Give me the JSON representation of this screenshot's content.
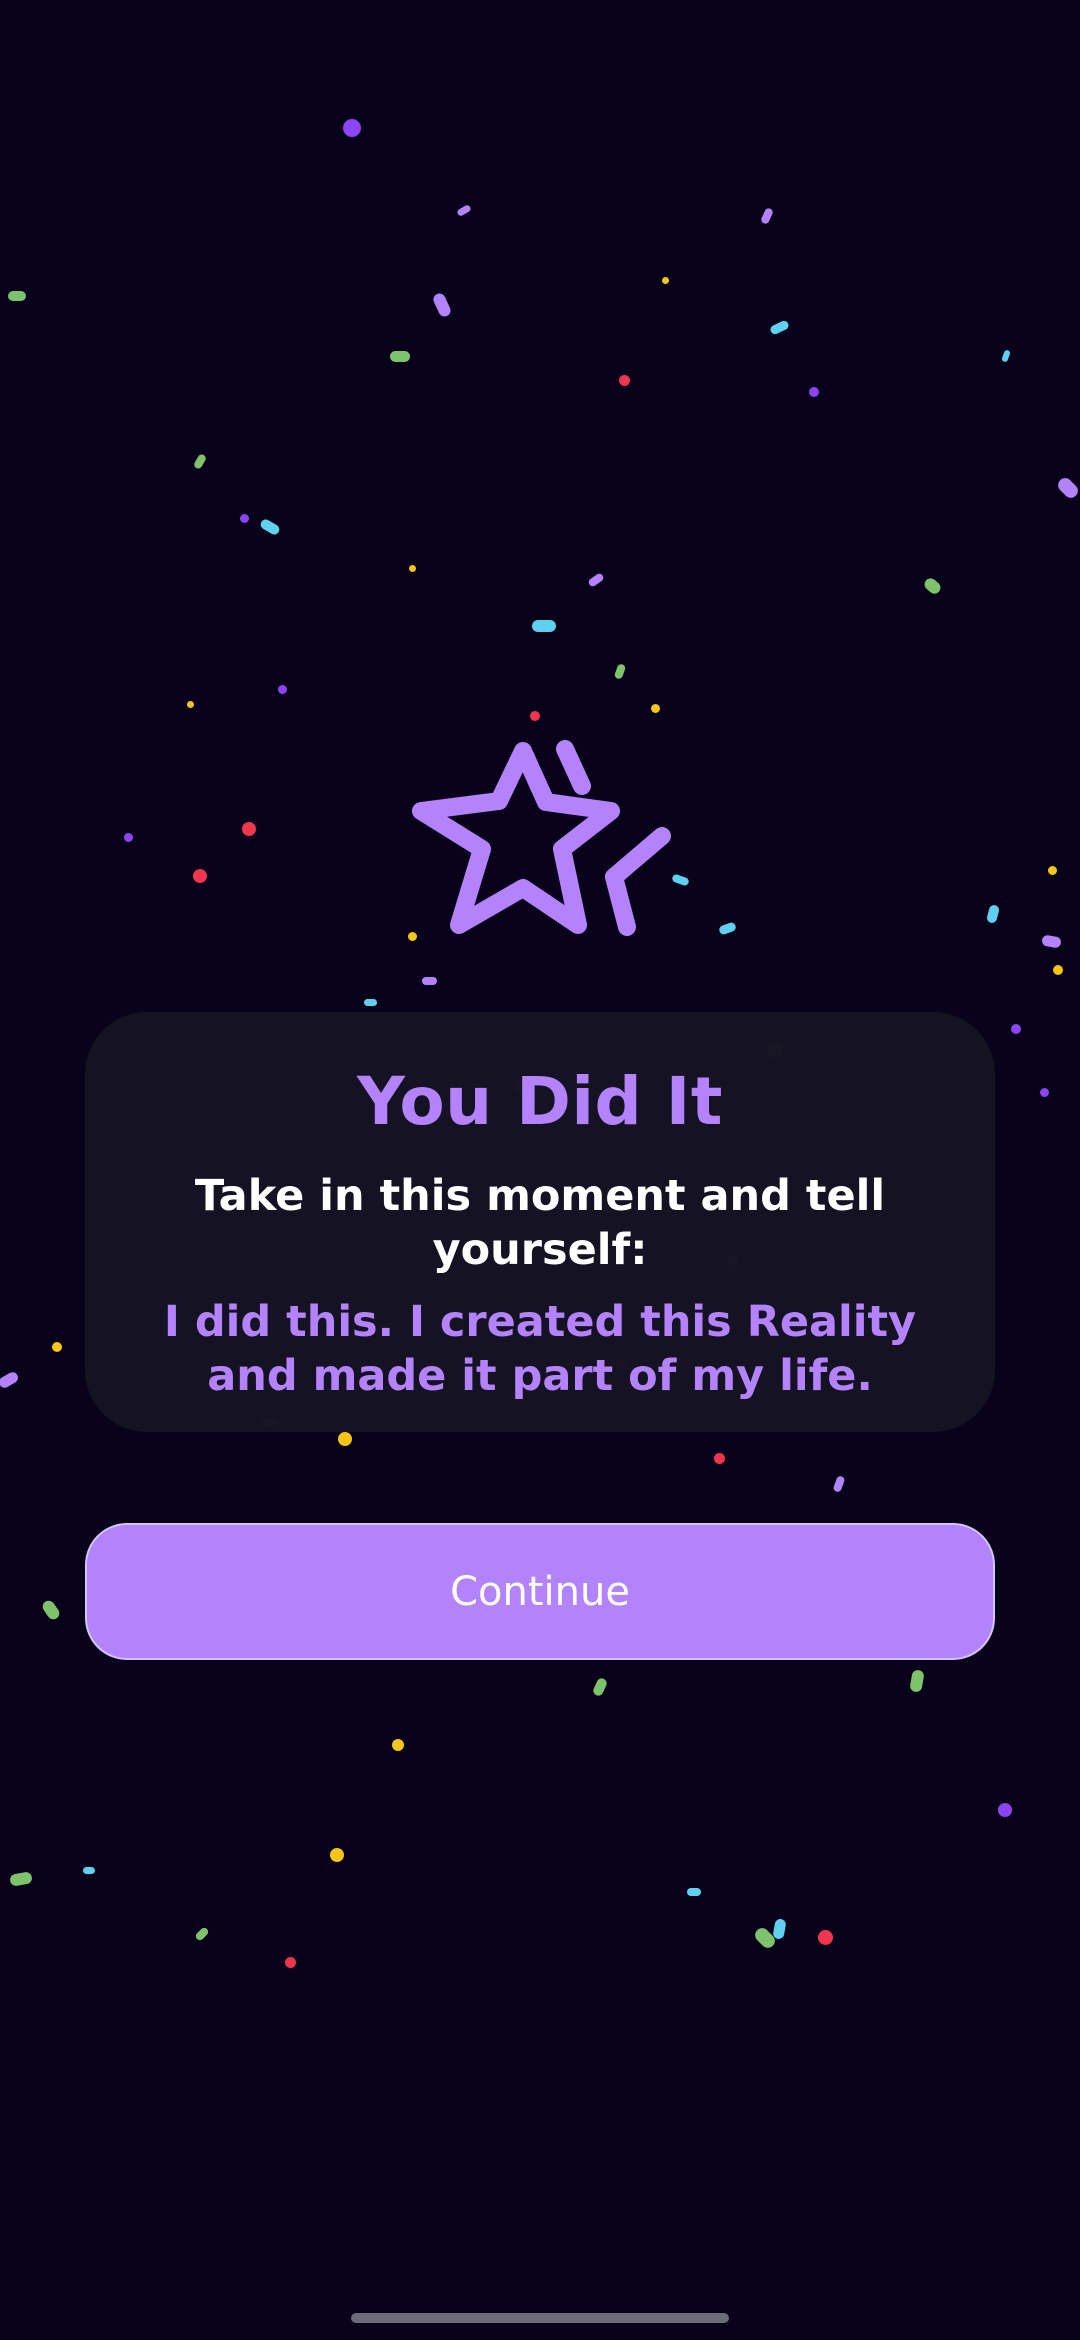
{
  "theme": {
    "background": "#08031a",
    "accent": "#b483fb",
    "card_background": "#161424",
    "button_background": "#b283fb",
    "text_primary": "#ffffff",
    "confetti_colors": [
      "#8b45f5",
      "#b483fb",
      "#5fd0ef",
      "#7ec36b",
      "#f5c518",
      "#f0364f"
    ]
  },
  "icon": {
    "name": "sparkle-star-icon"
  },
  "card": {
    "title": "You Did It",
    "prompt": "Take in this moment and tell yourself:",
    "affirmation": "I did this. I created this Reality and made it part of my life."
  },
  "actions": {
    "continue_label": "Continue"
  }
}
